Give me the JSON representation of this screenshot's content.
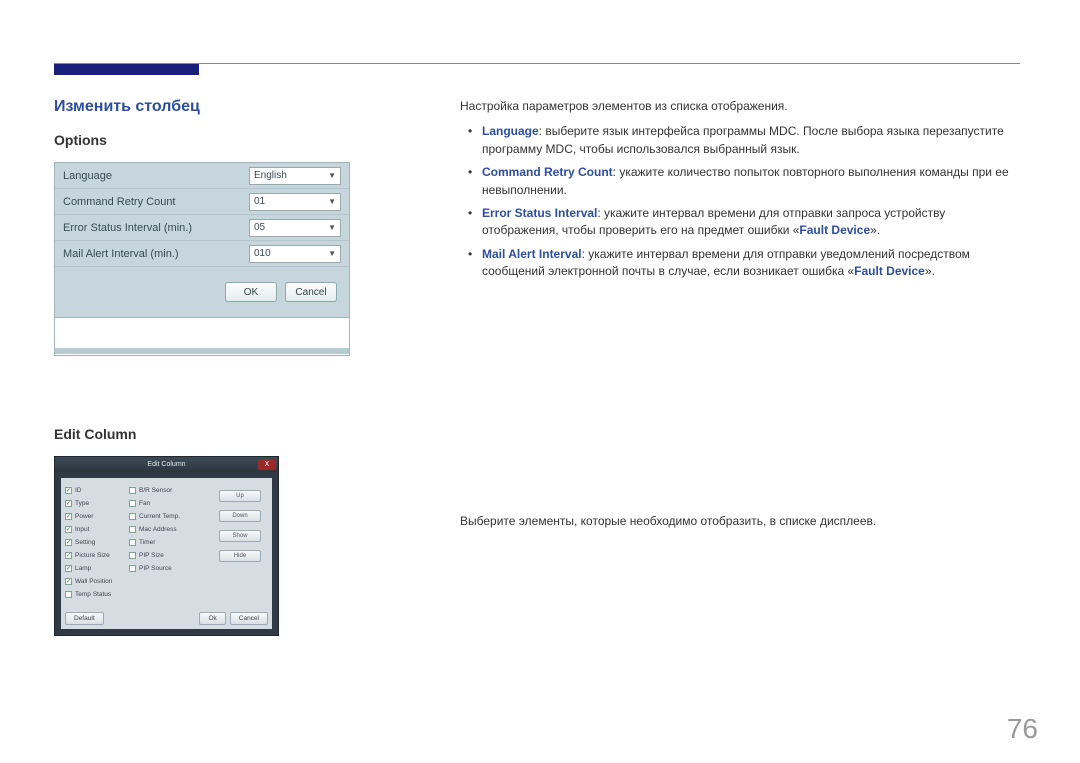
{
  "header": {
    "section_title": "Изменить столбец"
  },
  "options_section": {
    "heading": "Options",
    "rows": {
      "language": {
        "label": "Language",
        "value": "English"
      },
      "retry": {
        "label": "Command Retry Count",
        "value": "01"
      },
      "esi": {
        "label": "Error Status Interval (min.)",
        "value": "05"
      },
      "mai": {
        "label": "Mail Alert Interval (min.)",
        "value": "010"
      }
    },
    "buttons": {
      "ok": "OK",
      "cancel": "Cancel"
    }
  },
  "editcol_section": {
    "heading": "Edit Column",
    "dialog_title": "Edit Column",
    "close": "X",
    "left_items": [
      {
        "label": "ID",
        "checked": true
      },
      {
        "label": "Type",
        "checked": true
      },
      {
        "label": "Power",
        "checked": true
      },
      {
        "label": "Input",
        "checked": true
      },
      {
        "label": "Setting",
        "checked": true
      },
      {
        "label": "Picture Size",
        "checked": true
      },
      {
        "label": "Lamp",
        "checked": true
      },
      {
        "label": "Wall Position",
        "checked": true
      },
      {
        "label": "Temp Status",
        "checked": false
      }
    ],
    "right_items": [
      {
        "label": "B/R Sensor",
        "checked": false
      },
      {
        "label": "Fan",
        "checked": false
      },
      {
        "label": "Current Temp.",
        "checked": false
      },
      {
        "label": "Mac Address",
        "checked": false
      },
      {
        "label": "Timer",
        "checked": false
      },
      {
        "label": "PIP Size",
        "checked": false
      },
      {
        "label": "PIP Source",
        "checked": false
      }
    ],
    "side_buttons": {
      "up": "Up",
      "down": "Down",
      "show": "Show",
      "hide": "Hide"
    },
    "bottom_buttons": {
      "default": "Default",
      "ok": "Ok",
      "cancel": "Cancel"
    }
  },
  "right_text": {
    "intro": "Настройка параметров элементов из списка отображения.",
    "b1_term": "Language",
    "b1_text": ": выберите язык интерфейса программы MDC. После выбора языка перезапустите программу MDC, чтобы использовался выбранный язык.",
    "b2_term": "Command Retry Count",
    "b2_text": ": укажите количество попыток повторного выполнения команды при ее невыполнении.",
    "b3_term": "Error Status Interval",
    "b3_text_a": ": укажите интервал времени для отправки запроса устройству отображения, чтобы проверить его на предмет ошибки «",
    "b3_fault": "Fault Device",
    "b3_text_b": "».",
    "b4_term": "Mail Alert Interval",
    "b4_text_a": ": укажите интервал времени для отправки уведомлений посредством сообщений электронной почты в случае, если возникает ошибка «",
    "b4_fault": "Fault Device",
    "b4_text_b": "».",
    "ec_desc": "Выберите элементы, которые необходимо отобразить, в списке дисплеев."
  },
  "page_number": "76"
}
